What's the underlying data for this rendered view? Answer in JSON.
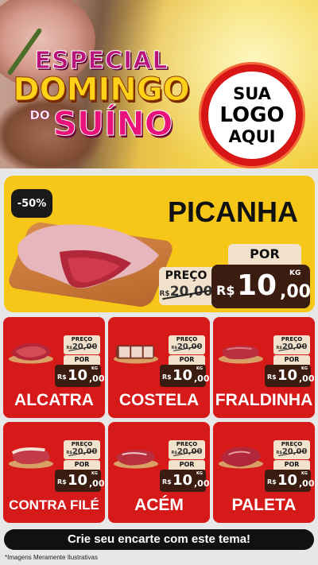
{
  "header": {
    "title_line1": "ESPECIAL",
    "title_line2": "DOMINGO",
    "title_small": "DO",
    "title_line3": "SUÍNO",
    "logo_line1": "SUA",
    "logo_line2": "LOGO",
    "logo_line3": "AQUI"
  },
  "featured": {
    "badge": "-50%",
    "name": "PICANHA",
    "por_label": "POR",
    "preco_label": "PREÇO",
    "old_currency": "R$",
    "old_price": "20,00",
    "currency": "R$",
    "price_int": "10",
    "price_dec": ",00",
    "unit": "KG"
  },
  "card_labels": {
    "preco_label": "PREÇO",
    "por_label": "POR",
    "old_currency": "R$",
    "currency": "R$",
    "unit": "KG"
  },
  "products": [
    {
      "name": "ALCATRA",
      "old_price": "20,00",
      "price_int": "10",
      "price_dec": ",00"
    },
    {
      "name": "COSTELA",
      "old_price": "20,00",
      "price_int": "10",
      "price_dec": ",00"
    },
    {
      "name": "FRALDINHA",
      "old_price": "20,00",
      "price_int": "10",
      "price_dec": ",00"
    },
    {
      "name": "CONTRA FILÉ",
      "old_price": "20,00",
      "price_int": "10",
      "price_dec": ",00"
    },
    {
      "name": "ACÉM",
      "old_price": "20,00",
      "price_int": "10",
      "price_dec": ",00"
    },
    {
      "name": "PALETA",
      "old_price": "20,00",
      "price_int": "10",
      "price_dec": ",00"
    }
  ],
  "footer": {
    "cta": "Crie seu encarte com este tema!",
    "disclaimer": "*Imagens Meramente Ilustrativas"
  },
  "colors": {
    "card_red": "#d61a1a",
    "featured_yellow": "#f6c718",
    "price_brown": "#3a1c10",
    "label_cream": "#f2e2cc"
  }
}
